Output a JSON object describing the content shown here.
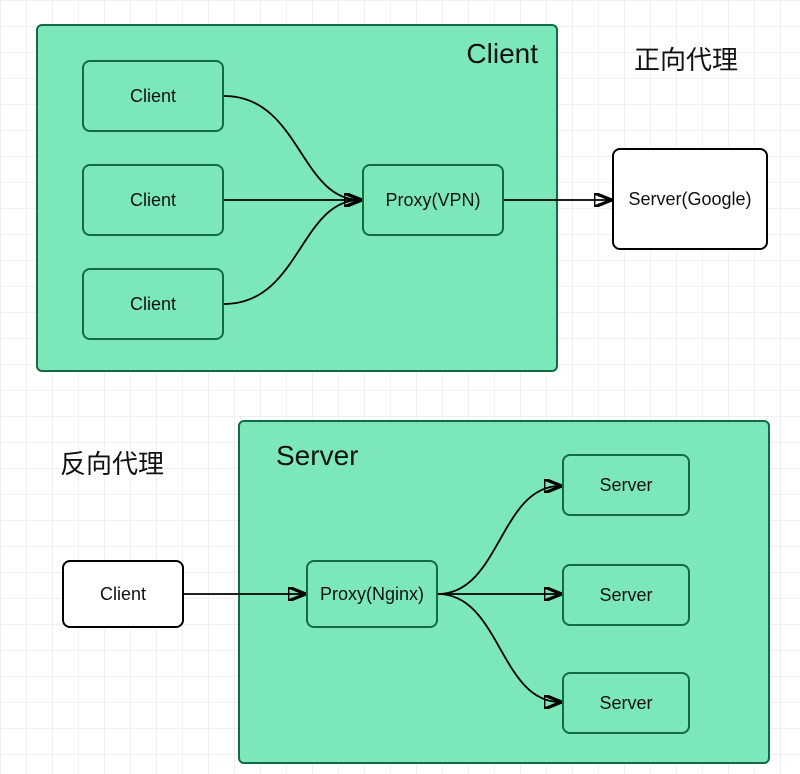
{
  "diagram1": {
    "group_label": "Client",
    "title": "正向代理",
    "clients": [
      "Client",
      "Client",
      "Client"
    ],
    "proxy_label": "Proxy(VPN)",
    "server_label": "Server(Google)"
  },
  "diagram2": {
    "group_label": "Server",
    "title": "反向代理",
    "client_label": "Client",
    "proxy_label": "Proxy(Nginx)",
    "servers": [
      "Server",
      "Server",
      "Server"
    ]
  }
}
